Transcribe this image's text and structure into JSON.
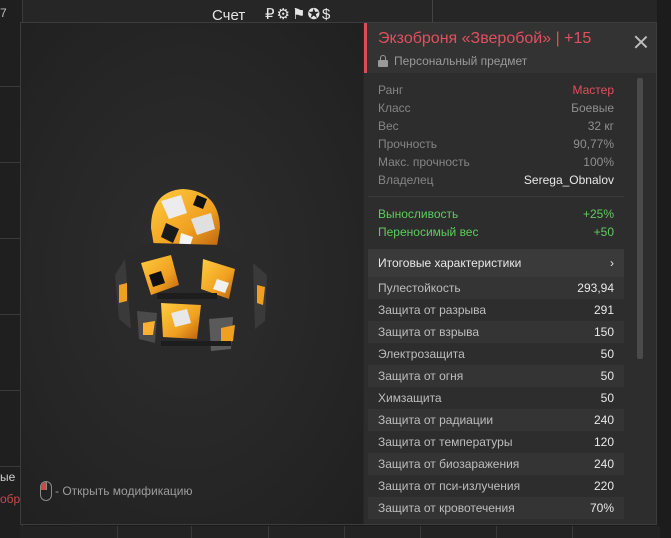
{
  "background": {
    "score_label": "Счет",
    "icons": [
      "ruble-icon",
      "gear-icon",
      "flag-icon",
      "settings-icon",
      "dollar-icon"
    ],
    "left_snippet_top": "7",
    "left_snippet_1": "ые",
    "left_snippet_2": "обр"
  },
  "item": {
    "title": "Экзоброня «Зверобой» | +15",
    "subtitle": "Персональный предмет"
  },
  "properties": [
    {
      "key": "Ранг",
      "value": "Мастер"
    },
    {
      "key": "Класс",
      "value": "Боевые"
    },
    {
      "key": "Вес",
      "value": "32 кг"
    },
    {
      "key": "Прочность",
      "value": "90,77%"
    },
    {
      "key": "Макс. прочность",
      "value": "100%"
    },
    {
      "key": "Владелец",
      "value": "Serega_Obnalov"
    }
  ],
  "bonuses": [
    {
      "key": "Выносливость",
      "value": "+25%"
    },
    {
      "key": "Переносимый вес",
      "value": "+50"
    }
  ],
  "summary": {
    "label": "Итоговые характеристики",
    "arrow": "›"
  },
  "stats": [
    {
      "key": "Пулестойкость",
      "value": "293,94"
    },
    {
      "key": "Защита от разрыва",
      "value": "291"
    },
    {
      "key": "Защита от взрыва",
      "value": "150"
    },
    {
      "key": "Электрозащита",
      "value": "50"
    },
    {
      "key": "Защита от огня",
      "value": "50"
    },
    {
      "key": "Химзащита",
      "value": "50"
    },
    {
      "key": "Защита от радиации",
      "value": "240"
    },
    {
      "key": "Защита от температуры",
      "value": "120"
    },
    {
      "key": "Защита от биозаражения",
      "value": "240"
    },
    {
      "key": "Защита от пси-излучения",
      "value": "220"
    },
    {
      "key": "Защита от кровотечения",
      "value": "70%"
    }
  ],
  "viewer": {
    "hint": "- Открыть модификацию"
  },
  "colors": {
    "accent": "#e0505e",
    "bonus": "#5fcb60",
    "armor_orange": "#f0a020"
  }
}
